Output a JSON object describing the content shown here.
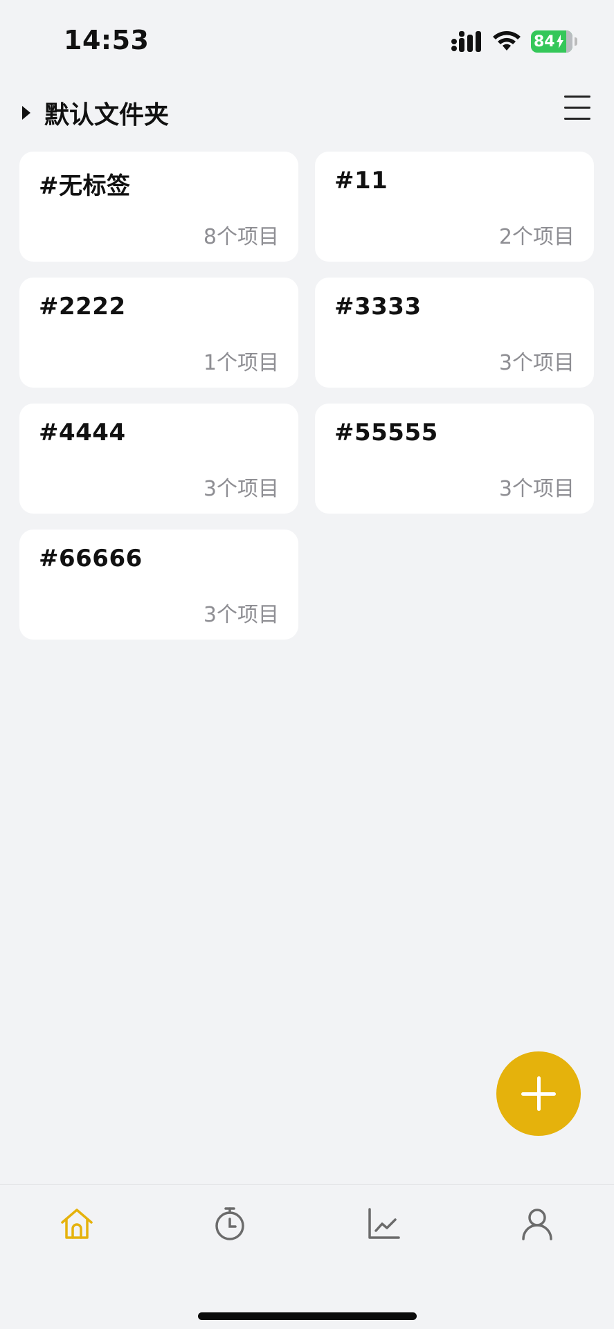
{
  "status_bar": {
    "time": "14:53",
    "battery": "84"
  },
  "header": {
    "folder_title": "默认文件夹"
  },
  "tags": [
    {
      "name": "#无标签",
      "count": "8个项目"
    },
    {
      "name": "#11",
      "count": "2个项目"
    },
    {
      "name": "#2222",
      "count": "1个项目"
    },
    {
      "name": "#3333",
      "count": "3个项目"
    },
    {
      "name": "#4444",
      "count": "3个项目"
    },
    {
      "name": "#55555",
      "count": "3个项目"
    },
    {
      "name": "#66666",
      "count": "3个项目"
    }
  ],
  "tab_bar": {
    "tabs": [
      {
        "icon": "home-icon",
        "active": true
      },
      {
        "icon": "timer-icon",
        "active": false
      },
      {
        "icon": "chart-icon",
        "active": false
      },
      {
        "icon": "profile-icon",
        "active": false
      }
    ]
  },
  "colors": {
    "accent": "#e5b20c",
    "background": "#f2f3f5",
    "card": "#ffffff",
    "muted_text": "#8e8e93",
    "battery": "#34c759",
    "inactive_icon": "#6b6b6b"
  }
}
